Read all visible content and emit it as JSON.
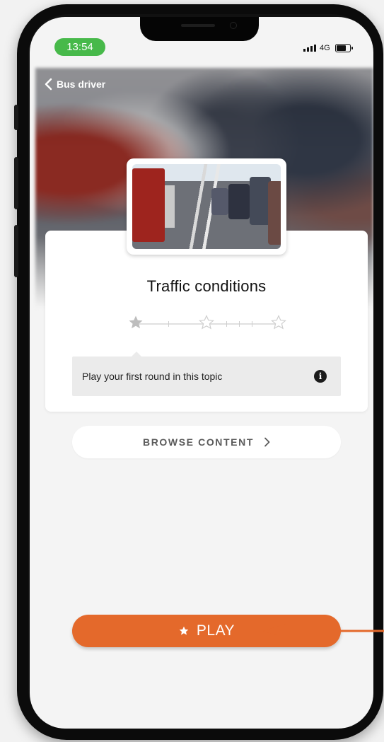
{
  "status_bar": {
    "time": "13:54",
    "network": "4G"
  },
  "header": {
    "back_label": "Bus driver"
  },
  "topic": {
    "title": "Traffic conditions",
    "stars_total": 3,
    "stars_earned": 0
  },
  "info": {
    "text": "Play your first round in this topic",
    "icon": "i"
  },
  "browse_button": {
    "label": "BROWSE CONTENT",
    "chevron": ">"
  },
  "play_button": {
    "label": "PLAY"
  },
  "colors": {
    "accent": "#e4692b",
    "status_time_bg": "#47b94a",
    "annotation_arrow": "#e4692b"
  },
  "icons": [
    "chevron-left-icon",
    "info-icon",
    "star-icon",
    "signal-icon",
    "battery-icon",
    "chevron-right-icon"
  ]
}
